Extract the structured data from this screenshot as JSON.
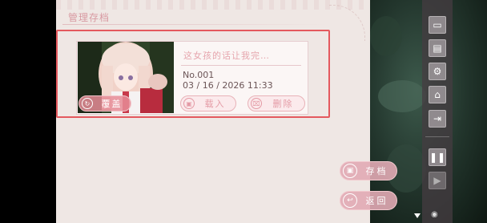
{
  "header": {
    "title": "管理存档"
  },
  "slot": {
    "title": "这女孩的话让我完…",
    "number": "No.001",
    "datetime": "03 / 16 / 2026  11:33",
    "overwrite_label": "覆盖",
    "load_label": "载入",
    "delete_label": "删除"
  },
  "actions": {
    "save_label": "存档",
    "back_label": "返回"
  },
  "sidebar": [
    "save-icon",
    "book-icon",
    "gear-icon",
    "home-icon",
    "exit-icon",
    "pause-icon",
    "play-icon"
  ],
  "colors": {
    "accent": "#e4595e",
    "pink": "#e49aa5",
    "panel": "#efe7e4"
  }
}
